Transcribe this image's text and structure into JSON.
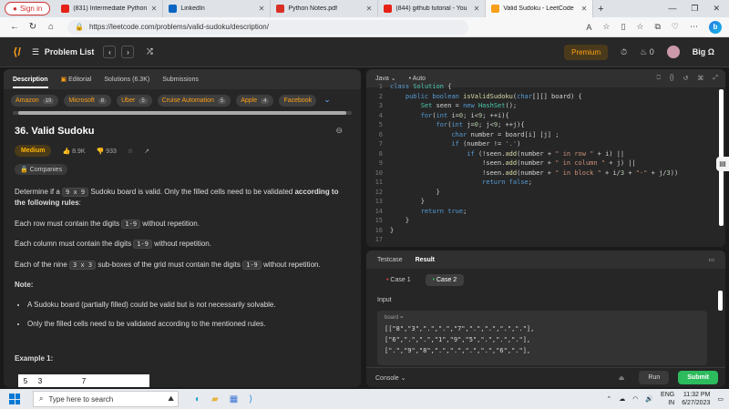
{
  "browser": {
    "signin_label": "Sign in",
    "tabs": [
      {
        "title": "(831) Intermediate Python",
        "color": "#e62117"
      },
      {
        "title": "LinkedIn",
        "color": "#0a66c2"
      },
      {
        "title": "Python Notes.pdf",
        "color": "#d93025"
      },
      {
        "title": "(844) github tutorial - You",
        "color": "#e62117"
      },
      {
        "title": "Valid Sudoku - LeetCode",
        "color": "#f89f1b"
      }
    ],
    "url": "https://leetcode.com/problems/valid-sudoku/description/"
  },
  "header": {
    "problem_list": "Problem List",
    "premium": "Premium",
    "streak": "0",
    "user": "Big Ω"
  },
  "left_tabs": [
    "Description",
    "Editorial",
    "Solutions (6.3K)",
    "Submissions"
  ],
  "companies": [
    {
      "name": "Amazon",
      "count": "19"
    },
    {
      "name": "Microsoft",
      "count": "8"
    },
    {
      "name": "Uber",
      "count": "5"
    },
    {
      "name": "Cruise Automation",
      "count": "5"
    },
    {
      "name": "Apple",
      "count": "4"
    },
    {
      "name": "Facebook",
      "count": ""
    }
  ],
  "problem": {
    "title": "36. Valid Sudoku",
    "difficulty": "Medium",
    "likes": "8.9K",
    "dislikes": "933",
    "companies_label": "Companies",
    "intro_a": "Determine if a ",
    "intro_code": "9 x 9",
    "intro_b": " Sudoku board is valid. Only the filled cells need to be validated ",
    "intro_bold": "according to the following rules",
    "intro_c": ":",
    "rule1_a": "Each row must contain the digits ",
    "rule_code": "1-9",
    "rule1_b": " without repetition.",
    "rule2_a": "Each column must contain the digits ",
    "rule2_b": " without repetition.",
    "rule3_a": "Each of the nine ",
    "rule3_code": "3 x 3",
    "rule3_b": " sub-boxes of the grid must contain the digits ",
    "rule3_c": " without repetition.",
    "note_label": "Note:",
    "note1": "A Sudoku board (partially filled) could be valid but is not necessarily solvable.",
    "note2": "Only the filled cells need to be validated according to the mentioned rules.",
    "example_label": "Example 1:",
    "grid_row": [
      "5",
      "3",
      "",
      "",
      "7",
      "",
      "",
      "",
      ""
    ]
  },
  "editor": {
    "language": "Java",
    "mode": "Auto",
    "line_numbers": [
      "1",
      "2",
      "3",
      "4",
      "5",
      "6",
      "7",
      "8",
      "9",
      "10",
      "11",
      "12",
      "13",
      "14",
      "15",
      "16",
      "17"
    ]
  },
  "bottom": {
    "tabs": [
      "Testcase",
      "Result"
    ],
    "cases": [
      "Case 1",
      "Case 2"
    ],
    "input_label": "Input",
    "board_label": "board =",
    "board_lines": [
      "[[\"8\",\"3\",\".\",\".\",\"7\",\".\",\".\",\".\",\".\"],",
      "[\"6\",\".\",\".\",\"1\",\"9\",\"5\",\".\",\".\",\".\"],",
      "[\".\",\"9\",\"8\",\".\",\".\",\".\",\".\",\"6\",\".\"],"
    ],
    "console": "Console",
    "run": "Run",
    "submit": "Submit"
  },
  "taskbar": {
    "search_placeholder": "Type here to search",
    "lang": "ENG",
    "region": "IN",
    "time": "11:32 PM",
    "date": "6/27/2023"
  }
}
